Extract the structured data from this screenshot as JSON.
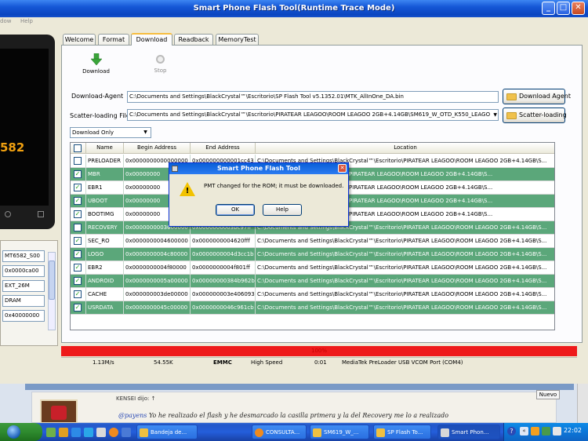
{
  "window": {
    "title": "Smart Phone Flash Tool(Runtime Trace Mode)",
    "menu": [
      "dow",
      "Help"
    ]
  },
  "tabs": [
    "Welcome",
    "Format",
    "Download",
    "Readback",
    "MemoryTest"
  ],
  "toolbar": {
    "download": "Download",
    "stop": "Stop"
  },
  "download_agent": {
    "label": "Download-Agent",
    "path": "C:\\Documents and Settings\\BlackCrystal™\\Escritorio\\SP Flash Tool v5.1352.01\\MTK_AllInOne_DA.bin",
    "button": "Download Agent"
  },
  "scatter": {
    "label": "Scatter-loading File",
    "path": "C:\\Documents and Settings\\BlackCrystal™\\Escritorio\\PIRATEAR LEAGOO\\ROOM LEAGOO 2GB+4.14GB\\SM619_W_OTD_K550_LEAGO",
    "button": "Scatter-loading"
  },
  "mode_select": "Download Only",
  "table": {
    "headers": [
      "Name",
      "Begin Address",
      "End Address",
      "Location"
    ],
    "rows": [
      {
        "checked": false,
        "name": "PRELOADER",
        "begin": "0x0000000000000000",
        "end": "0x000000000001cc43",
        "location": "C:\\Documents and Settings\\BlackCrystal™\\Escritorio\\PIRATEAR LEAGOO\\ROOM LEAGOO 2GB+4.14GB\\S...",
        "green": false
      },
      {
        "checked": true,
        "name": "MBR",
        "begin": "0x00000000",
        "end": "",
        "location": "...ttings\\BlackCrystal™\\Escritorio\\PIRATEAR LEAGOO\\ROOM LEAGOO 2GB+4.14GB\\S...",
        "green": true
      },
      {
        "checked": true,
        "name": "EBR1",
        "begin": "0x00000000",
        "end": "",
        "location": "...ttings\\BlackCrystal™\\Escritorio\\PIRATEAR LEAGOO\\ROOM LEAGOO 2GB+4.14GB\\S...",
        "green": false
      },
      {
        "checked": true,
        "name": "UBOOT",
        "begin": "0x00000000",
        "end": "",
        "location": "...ttings\\BlackCrystal™\\Escritorio\\PIRATEAR LEAGOO\\ROOM LEAGOO 2GB+4.14GB\\S...",
        "green": true
      },
      {
        "checked": true,
        "name": "BOOTIMG",
        "begin": "0x00000000",
        "end": "",
        "location": "...ttings\\BlackCrystal™\\Escritorio\\PIRATEAR LEAGOO\\ROOM LEAGOO 2GB+4.14GB\\S...",
        "green": false
      },
      {
        "checked": false,
        "name": "RECOVERY",
        "begin": "0x0000000003600000",
        "end": "0x0000000003bc97ff",
        "location": "C:\\Documents and Settings\\BlackCrystal™\\Escritorio\\PIRATEAR LEAGOO\\ROOM LEAGOO 2GB+4.14GB\\S...",
        "green": true
      },
      {
        "checked": true,
        "name": "SEC_RO",
        "begin": "0x0000000004600000",
        "end": "0x0000000004620fff",
        "location": "C:\\Documents and Settings\\BlackCrystal™\\Escritorio\\PIRATEAR LEAGOO\\ROOM LEAGOO 2GB+4.14GB\\S...",
        "green": false
      },
      {
        "checked": true,
        "name": "LOGO",
        "begin": "0x0000000004c80000",
        "end": "0x0000000004d3cc1b",
        "location": "C:\\Documents and Settings\\BlackCrystal™\\Escritorio\\PIRATEAR LEAGOO\\ROOM LEAGOO 2GB+4.14GB\\S...",
        "green": true
      },
      {
        "checked": true,
        "name": "EBR2",
        "begin": "0x0000000004f80000",
        "end": "0x0000000004f801ff",
        "location": "C:\\Documents and Settings\\BlackCrystal™\\Escritorio\\PIRATEAR LEAGOO\\ROOM LEAGOO 2GB+4.14GB\\S...",
        "green": false
      },
      {
        "checked": true,
        "name": "ANDROID",
        "begin": "0x0000000005a00000",
        "end": "0x00000000384b962b",
        "location": "C:\\Documents and Settings\\BlackCrystal™\\Escritorio\\PIRATEAR LEAGOO\\ROOM LEAGOO 2GB+4.14GB\\S...",
        "green": true
      },
      {
        "checked": true,
        "name": "CACHE",
        "begin": "0x000000003de00000",
        "end": "0x000000003e406093",
        "location": "C:\\Documents and Settings\\BlackCrystal™\\Escritorio\\PIRATEAR LEAGOO\\ROOM LEAGOO 2GB+4.14GB\\S...",
        "green": false
      },
      {
        "checked": true,
        "name": "USRDATA",
        "begin": "0x0000000045c00000",
        "end": "0x0000000046c961cb",
        "location": "C:\\Documents and Settings\\BlackCrystal™\\Escritorio\\PIRATEAR LEAGOO\\ROOM LEAGOO 2GB+4.14GB\\S...",
        "green": true
      }
    ]
  },
  "dialog": {
    "title": "Smart Phone Flash Tool",
    "message": "PMT changed for the ROM; it must be downloaded.",
    "ok": "OK",
    "help": "Help"
  },
  "phone": {
    "display": "582"
  },
  "info_fields": [
    "MT6582_S00",
    "0x0000ca00",
    "EXT_26M",
    "DRAM",
    "0x40000000"
  ],
  "progress": {
    "percent": 100
  },
  "status": {
    "speed": "1.13M/s",
    "size": "54.55K",
    "storage": "EMMC",
    "usb_speed": "High Speed",
    "time": "0:01",
    "port": "MediaTek PreLoader USB VCOM Port (COM4)"
  },
  "browser": {
    "author": "KENSEI dijo: ↑",
    "mention": "@payens",
    "text": " Yo he realizado el flash y he desmarcado la casilla primera y la del Recovery me lo a realizado",
    "nuevo": "Nuevo"
  },
  "taskbar": {
    "items": [
      "Bandeja de...",
      "CONSULTA...",
      "SM619_W_...",
      "SP Flash To...",
      "Smart Phon..."
    ],
    "clock": "22:02"
  },
  "colors": {
    "row_green": "#5ba77a",
    "progress_red": "#ee1a1a",
    "title_blue": "#0b45c0"
  }
}
